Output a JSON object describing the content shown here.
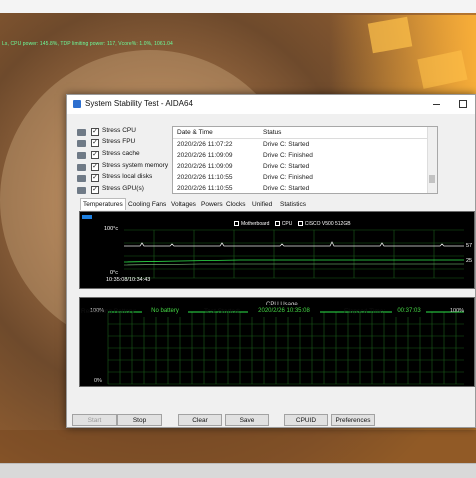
{
  "overlay_text": "Ls, CPU power: 145.8%, TDP limiting power: 117, Vcore%: 1.0%, 1061.04",
  "window": {
    "title": "System Stability Test - AIDA64"
  },
  "stress_options": [
    {
      "label": "Stress CPU",
      "checked": true,
      "icon": "cpu-icon"
    },
    {
      "label": "Stress FPU",
      "checked": true,
      "icon": "fpu-icon"
    },
    {
      "label": "Stress cache",
      "checked": true,
      "icon": "cache-icon"
    },
    {
      "label": "Stress system memory",
      "checked": true,
      "icon": "memory-icon"
    },
    {
      "label": "Stress local disks",
      "checked": true,
      "icon": "disk-icon"
    },
    {
      "label": "Stress GPU(s)",
      "checked": true,
      "icon": "gpu-icon"
    }
  ],
  "log": {
    "headers": [
      "Date & Time",
      "Status"
    ],
    "rows": [
      [
        "2020/2/26 11:07:22",
        "Drive C: Started"
      ],
      [
        "2020/2/26 11:09:09",
        "Drive C: Finished"
      ],
      [
        "2020/2/26 11:09:09",
        "Drive C: Started"
      ],
      [
        "2020/2/26 11:10:55",
        "Drive C: Finished"
      ],
      [
        "2020/2/26 11:10:55",
        "Drive C: Started"
      ]
    ]
  },
  "tabs": [
    "Temperatures",
    "Cooling Fans",
    "Voltages",
    "Powers",
    "Clocks",
    "Unified",
    "Statistics"
  ],
  "active_tab": "Temperatures",
  "temp_graph": {
    "legend": [
      "Motherboard",
      "CPU",
      "CISCO V500 512GB"
    ],
    "y_top": "100°c",
    "y_bottom": "0°c",
    "time_label": "10:35:08/10:34:43",
    "value_hi": "57",
    "value_lo": "25"
  },
  "cpu_graph": {
    "title": "CPU Usage",
    "y_top_left": "100%",
    "y_top_right": "100%",
    "y_bottom_left": "0%"
  },
  "status": {
    "remaining_battery_label": "Remaining Battery:",
    "remaining_battery_value": "No battery",
    "test_started_label": "Test Started:",
    "test_started_value": "2020/2/26 10:35:08",
    "elapsed_label": "Elapsed Time:",
    "elapsed_value": "00:37:03"
  },
  "buttons": {
    "start": "Start",
    "stop": "Stop",
    "clear": "Clear",
    "save": "Save",
    "cpuid": "CPUID",
    "preferences": "Preferences"
  },
  "colors": {
    "graph_grid": "#1a5d1a",
    "temp_line_1": "#e8e8e8",
    "temp_line_2": "#2ee64a",
    "status_text": "#45d745",
    "accent": "#1d7fe0"
  }
}
